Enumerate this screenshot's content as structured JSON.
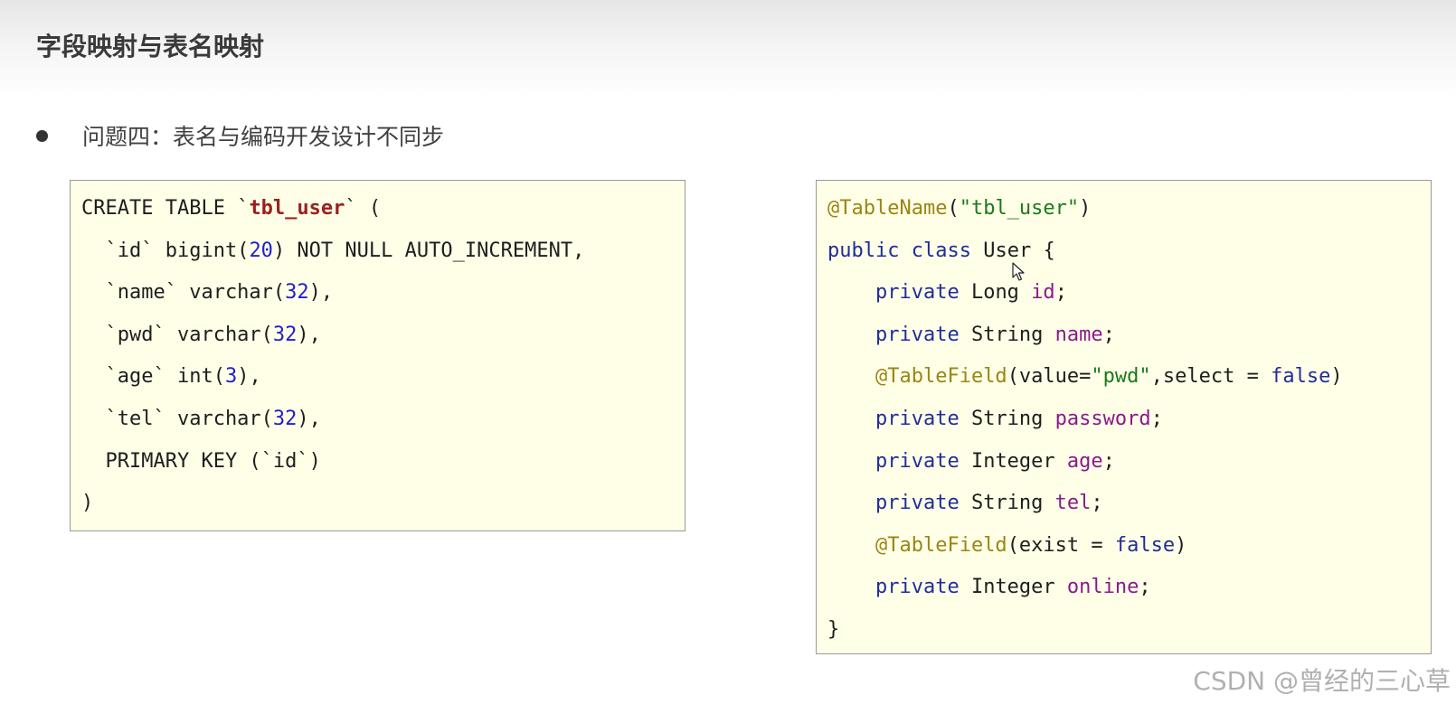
{
  "slide": {
    "title": "字段映射与表名映射",
    "bullet": "问题四：表名与编码开发设计不同步"
  },
  "sql_code": {
    "lines": [
      [
        {
          "t": "CREATE TABLE `",
          "c": ""
        },
        {
          "t": "tbl_user",
          "c": "bold"
        },
        {
          "t": "` (",
          "c": ""
        }
      ],
      [
        {
          "t": "  `id` bigint(",
          "c": ""
        },
        {
          "t": "20",
          "c": "num"
        },
        {
          "t": ") NOT NULL AUTO_INCREMENT,",
          "c": ""
        }
      ],
      [
        {
          "t": "  `name` varchar(",
          "c": ""
        },
        {
          "t": "32",
          "c": "num"
        },
        {
          "t": "),",
          "c": ""
        }
      ],
      [
        {
          "t": "  `pwd` varchar(",
          "c": ""
        },
        {
          "t": "32",
          "c": "num"
        },
        {
          "t": "),",
          "c": ""
        }
      ],
      [
        {
          "t": "  `age` int(",
          "c": ""
        },
        {
          "t": "3",
          "c": "num"
        },
        {
          "t": "),",
          "c": ""
        }
      ],
      [
        {
          "t": "  `tel` varchar(",
          "c": ""
        },
        {
          "t": "32",
          "c": "num"
        },
        {
          "t": "),",
          "c": ""
        }
      ],
      [
        {
          "t": "  PRIMARY KEY (`id`)",
          "c": ""
        }
      ],
      [
        {
          "t": ")",
          "c": ""
        }
      ]
    ]
  },
  "java_code": {
    "lines": [
      [
        {
          "t": "@TableName",
          "c": "ann"
        },
        {
          "t": "(",
          "c": ""
        },
        {
          "t": "\"tbl_user\"",
          "c": "str"
        },
        {
          "t": ")",
          "c": ""
        }
      ],
      [
        {
          "t": "public",
          "c": "kw"
        },
        {
          "t": " ",
          "c": ""
        },
        {
          "t": "class",
          "c": "kw"
        },
        {
          "t": " User {",
          "c": ""
        }
      ],
      [
        {
          "t": "    ",
          "c": ""
        },
        {
          "t": "private",
          "c": "kw"
        },
        {
          "t": " Long ",
          "c": ""
        },
        {
          "t": "id",
          "c": "field"
        },
        {
          "t": ";",
          "c": ""
        }
      ],
      [
        {
          "t": "    ",
          "c": ""
        },
        {
          "t": "private",
          "c": "kw"
        },
        {
          "t": " String ",
          "c": ""
        },
        {
          "t": "name",
          "c": "field"
        },
        {
          "t": ";",
          "c": ""
        }
      ],
      [
        {
          "t": "    ",
          "c": ""
        },
        {
          "t": "@TableField",
          "c": "ann"
        },
        {
          "t": "(value=",
          "c": ""
        },
        {
          "t": "\"pwd\"",
          "c": "str"
        },
        {
          "t": ",select = ",
          "c": ""
        },
        {
          "t": "false",
          "c": "kw"
        },
        {
          "t": ")",
          "c": ""
        }
      ],
      [
        {
          "t": "    ",
          "c": ""
        },
        {
          "t": "private",
          "c": "kw"
        },
        {
          "t": " String ",
          "c": ""
        },
        {
          "t": "password",
          "c": "field"
        },
        {
          "t": ";",
          "c": ""
        }
      ],
      [
        {
          "t": "    ",
          "c": ""
        },
        {
          "t": "private",
          "c": "kw"
        },
        {
          "t": " Integer ",
          "c": ""
        },
        {
          "t": "age",
          "c": "field"
        },
        {
          "t": ";",
          "c": ""
        }
      ],
      [
        {
          "t": "    ",
          "c": ""
        },
        {
          "t": "private",
          "c": "kw"
        },
        {
          "t": " String ",
          "c": ""
        },
        {
          "t": "tel",
          "c": "field"
        },
        {
          "t": ";",
          "c": ""
        }
      ],
      [
        {
          "t": "    ",
          "c": ""
        },
        {
          "t": "@TableField",
          "c": "ann"
        },
        {
          "t": "(exist = ",
          "c": ""
        },
        {
          "t": "false",
          "c": "kw"
        },
        {
          "t": ")",
          "c": ""
        }
      ],
      [
        {
          "t": "    ",
          "c": ""
        },
        {
          "t": "private",
          "c": "kw"
        },
        {
          "t": " Integer ",
          "c": ""
        },
        {
          "t": "online",
          "c": "field"
        },
        {
          "t": ";",
          "c": ""
        }
      ],
      [
        {
          "t": "}",
          "c": ""
        }
      ]
    ]
  },
  "watermark": "CSDN @曾经的三心草",
  "colors": {
    "code_background": "#ffffe8",
    "keyword": "#1f2d9a",
    "number": "#1f1fd0",
    "string": "#1a7a1a",
    "annotation": "#9b8514",
    "field": "#8a1a8a",
    "table_name": "#9b1f1f"
  },
  "icons": {
    "cursor": "mouse-pointer-icon"
  }
}
